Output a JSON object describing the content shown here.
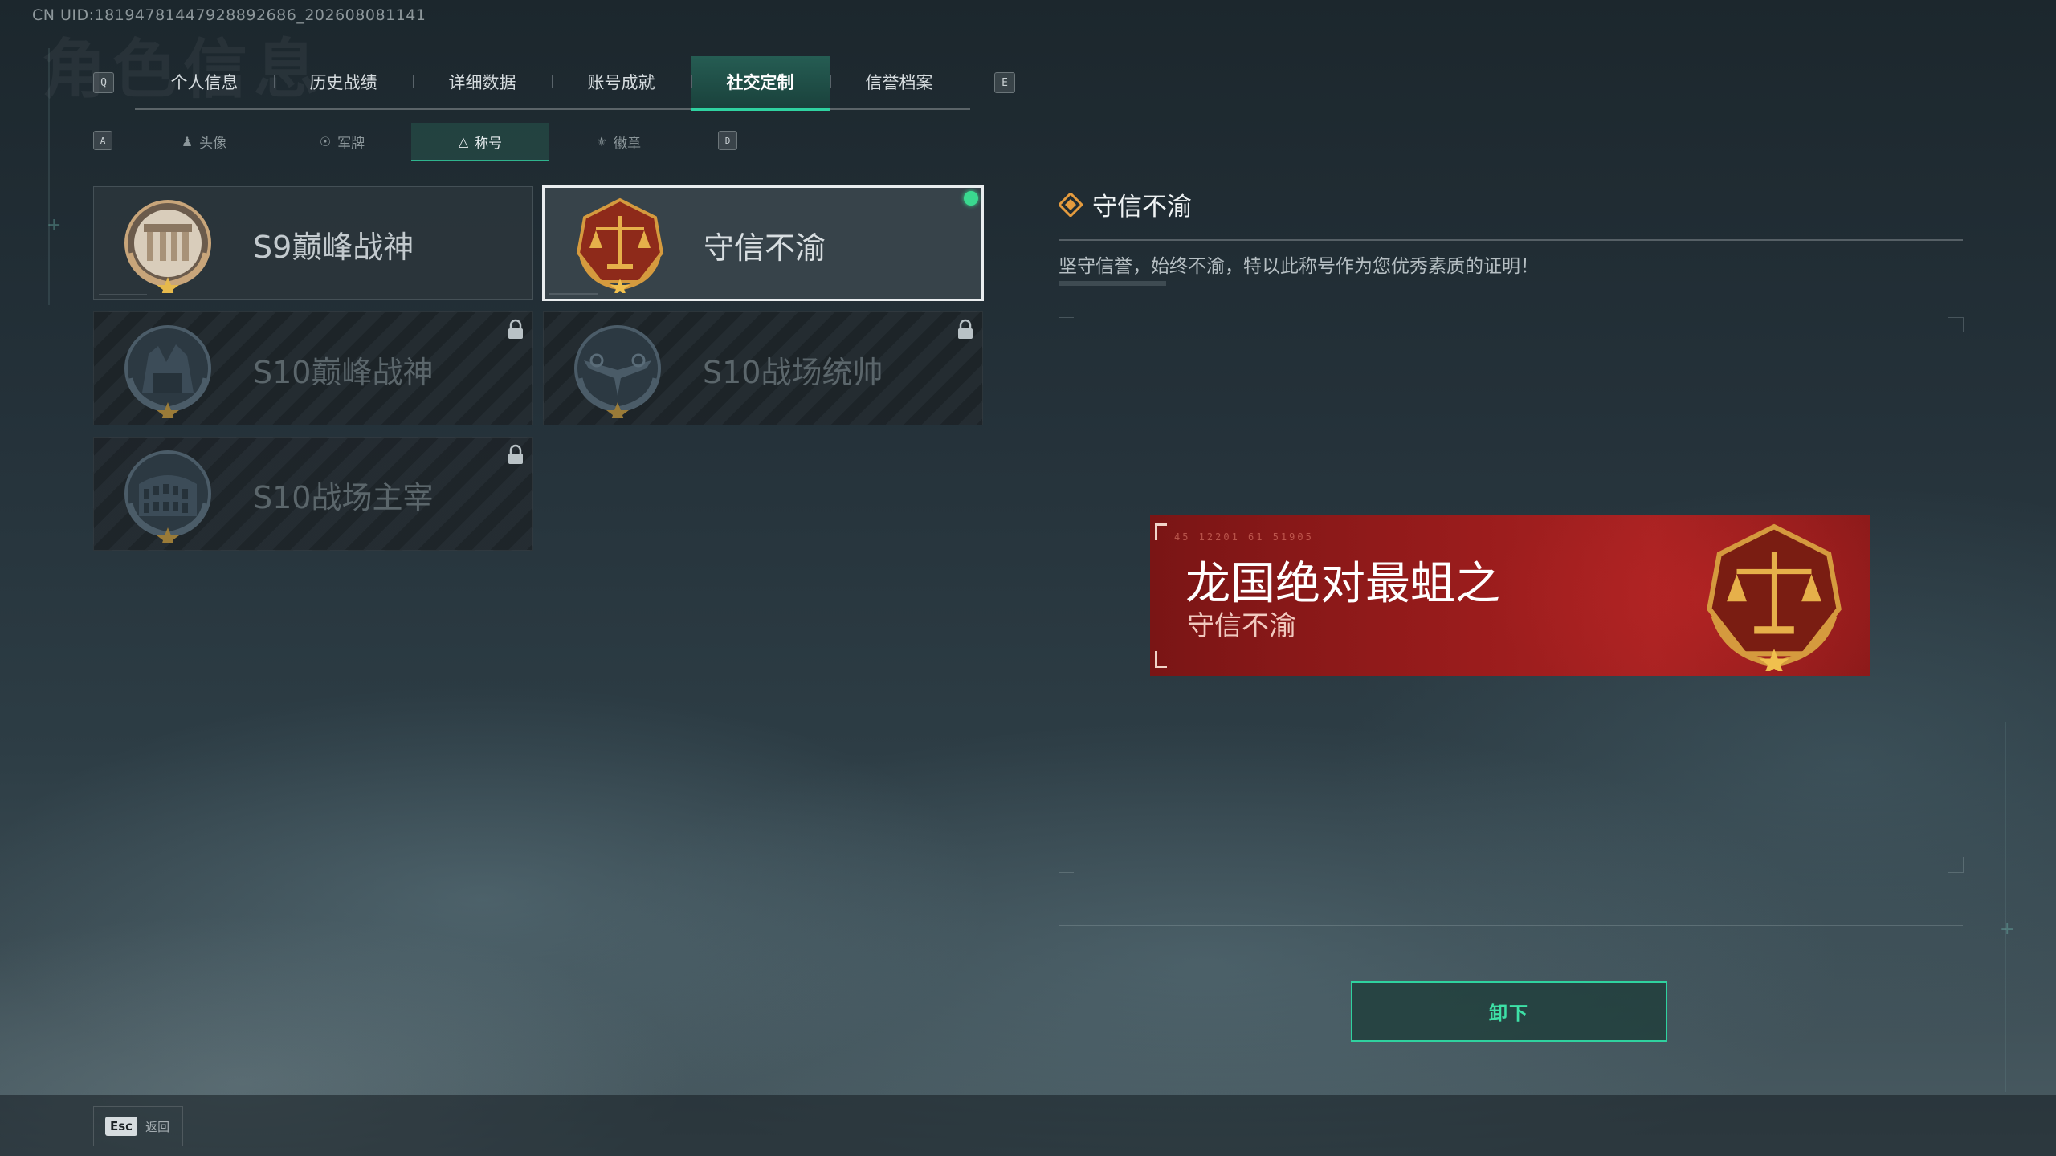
{
  "uid_text": "CN UID:1819478144792889​2686_202608081141",
  "main_tabs": {
    "prev_key": "Q",
    "next_key": "E",
    "items": [
      {
        "label": "个人信息"
      },
      {
        "label": "历史战绩"
      },
      {
        "label": "详细数据"
      },
      {
        "label": "账号成就"
      },
      {
        "label": "社交定制",
        "active": true
      },
      {
        "label": "信誉档案"
      }
    ]
  },
  "sub_tabs": {
    "prev_key": "A",
    "next_key": "D",
    "items": [
      {
        "label": "头像",
        "icon": "person-icon"
      },
      {
        "label": "军牌",
        "icon": "dogtag-icon"
      },
      {
        "label": "称号",
        "icon": "title-icon",
        "active": true
      },
      {
        "label": "徽章",
        "icon": "badge-icon"
      }
    ]
  },
  "titles": [
    {
      "name": "S9巅峰战神",
      "badge": "gate-badge",
      "state": "unlocked"
    },
    {
      "name": "守信不渝",
      "badge": "scales-badge",
      "state": "equipped"
    },
    {
      "name": "S10巅峰战神",
      "badge": "ruins-badge",
      "state": "locked"
    },
    {
      "name": "S10战场统帅",
      "badge": "aircraft-badge",
      "state": "locked"
    },
    {
      "name": "S10战场主宰",
      "badge": "colosseum-badge",
      "state": "locked"
    }
  ],
  "detail": {
    "name": "守信不渝",
    "description": "坚守信誉，始终不渝，特以此称号作为您优秀素质的证明！"
  },
  "banner": {
    "code": "45 12201  61 51905",
    "player_name": "龙国绝对最蛆之",
    "title": "守信不渝"
  },
  "unequip_label": "卸下",
  "footer": {
    "key": "Esc",
    "label": "返回"
  },
  "colors": {
    "accent": "#2fd29f",
    "banner_red": "#9a1c1c",
    "equipped_dot": "#3ad98f"
  }
}
